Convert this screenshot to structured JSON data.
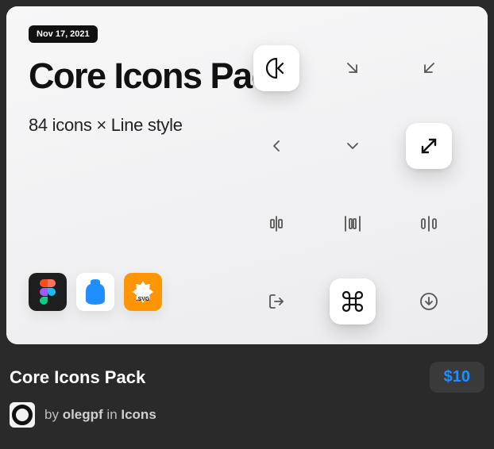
{
  "preview": {
    "date": "Nov 17, 2021",
    "title": "Core Icons Pack",
    "subtitle": "84 icons × Line style"
  },
  "formats": {
    "figma": "figma",
    "jar": "jar",
    "svg": ".SVG"
  },
  "product": {
    "name": "Core Icons Pack",
    "price": "$10",
    "by_prefix": "by ",
    "author": "olegpf",
    "in_word": " in ",
    "category": "Icons"
  }
}
